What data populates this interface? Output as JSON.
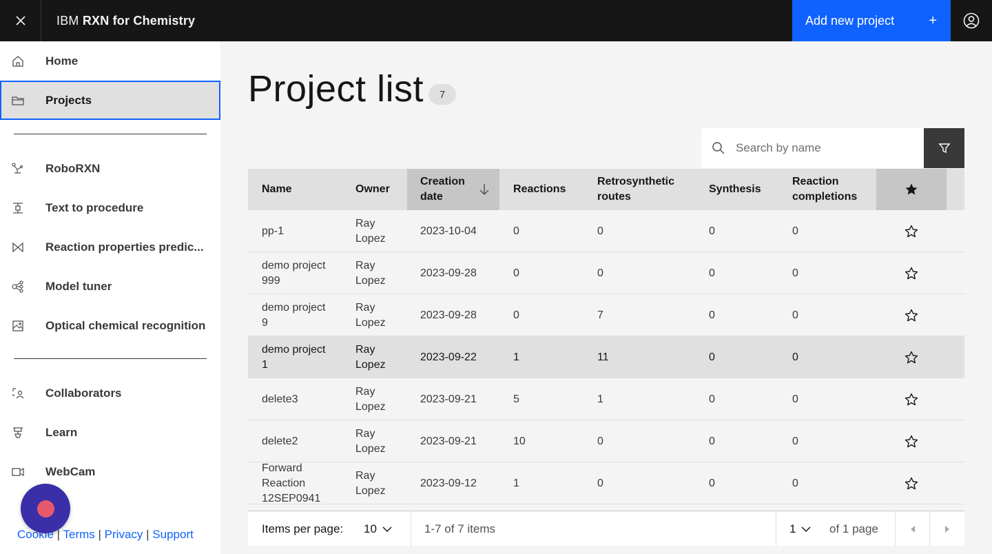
{
  "header": {
    "brand_prefix": "IBM",
    "brand_name": "RXN for Chemistry",
    "add_project_label": "Add new project",
    "add_project_icon": "+"
  },
  "sidebar": {
    "items": [
      {
        "label": "Home",
        "icon": "home-icon"
      },
      {
        "label": "Projects",
        "icon": "folder-icon",
        "active": true
      },
      {
        "label": "RoboRXN",
        "icon": "robot-icon"
      },
      {
        "label": "Text to procedure",
        "icon": "procedure-icon"
      },
      {
        "label": "Reaction properties predic...",
        "icon": "reaction-icon"
      },
      {
        "label": "Model tuner",
        "icon": "model-icon"
      },
      {
        "label": "Optical chemical recognition",
        "icon": "image-icon"
      },
      {
        "label": "Collaborators",
        "icon": "collaborators-icon"
      },
      {
        "label": "Learn",
        "icon": "learn-icon"
      },
      {
        "label": "WebCam",
        "icon": "webcam-icon"
      }
    ],
    "footer": {
      "cookie": "Cookie",
      "terms": "Terms",
      "privacy": "Privacy",
      "support": "Support",
      "separator": "|"
    }
  },
  "main": {
    "title": "Project list",
    "count": "7",
    "search": {
      "placeholder": "Search by name",
      "value": ""
    },
    "table": {
      "headers": {
        "name": "Name",
        "owner": "Owner",
        "creation_date": "Creation date",
        "reactions": "Reactions",
        "retrosynthetic": "Retrosynthetic routes",
        "synthesis": "Synthesis",
        "completions": "Reaction completions"
      },
      "rows": [
        {
          "name": "pp-1",
          "owner": "Ray Lopez",
          "date": "2023-10-04",
          "reactions": "0",
          "retro": "0",
          "synthesis": "0",
          "completions": "0"
        },
        {
          "name": "demo project 999",
          "owner": "Ray Lopez",
          "date": "2023-09-28",
          "reactions": "0",
          "retro": "0",
          "synthesis": "0",
          "completions": "0"
        },
        {
          "name": "demo project 9",
          "owner": "Ray Lopez",
          "date": "2023-09-28",
          "reactions": "0",
          "retro": "7",
          "synthesis": "0",
          "completions": "0"
        },
        {
          "name": "demo project 1",
          "owner": "Ray Lopez",
          "date": "2023-09-22",
          "reactions": "1",
          "retro": "11",
          "synthesis": "0",
          "completions": "0"
        },
        {
          "name": "delete3",
          "owner": "Ray Lopez",
          "date": "2023-09-21",
          "reactions": "5",
          "retro": "1",
          "synthesis": "0",
          "completions": "0"
        },
        {
          "name": "delete2",
          "owner": "Ray Lopez",
          "date": "2023-09-21",
          "reactions": "10",
          "retro": "0",
          "synthesis": "0",
          "completions": "0"
        },
        {
          "name": "Forward Reaction 12SEP0941",
          "owner": "Ray Lopez",
          "date": "2023-09-12",
          "reactions": "1",
          "retro": "0",
          "synthesis": "0",
          "completions": "0"
        }
      ]
    },
    "pagination": {
      "items_per_page_label": "Items per page:",
      "items_per_page": "10",
      "range": "1-7 of 7 items",
      "page": "1",
      "of_pages": "of 1 page"
    }
  },
  "colors": {
    "accent": "#0f62fe",
    "header_bg": "#161616",
    "record_button": "#3a2fa8",
    "record_dot": "#e6586a"
  }
}
